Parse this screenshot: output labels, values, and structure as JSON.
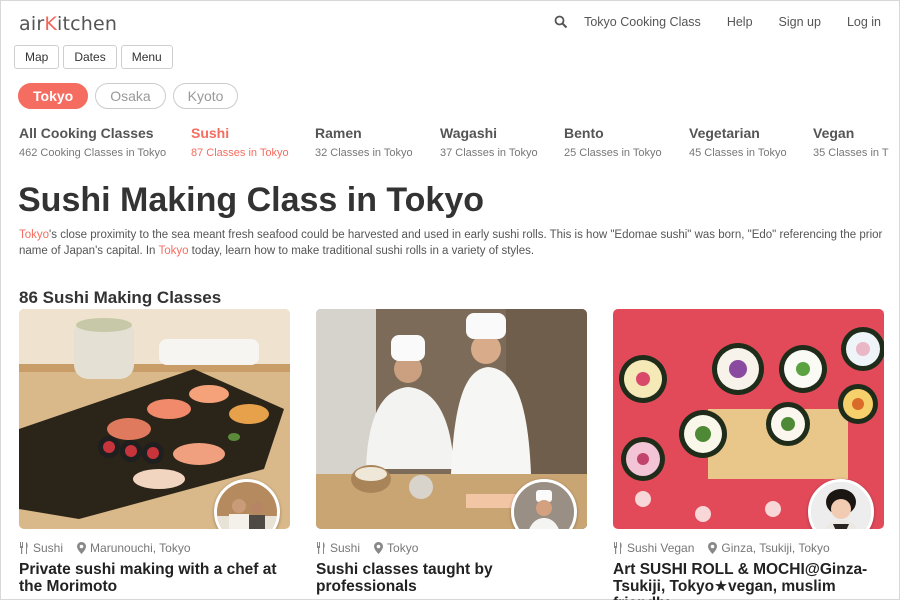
{
  "brand": {
    "logo_pre": "air",
    "logo_k": "K",
    "logo_post": "itchen"
  },
  "topnav": {
    "link1": "Tokyo Cooking Class",
    "link2": "Help",
    "link3": "Sign up",
    "link4": "Log in"
  },
  "filters": {
    "map": "Map",
    "dates": "Dates",
    "menu": "Menu"
  },
  "cities": [
    "Tokyo",
    "Osaka",
    "Kyoto"
  ],
  "categories": [
    {
      "name": "All Cooking Classes",
      "count": "462 Cooking Classes in Tokyo"
    },
    {
      "name": "Sushi",
      "count": "87 Classes in Tokyo"
    },
    {
      "name": "Ramen",
      "count": "32 Classes in Tokyo"
    },
    {
      "name": "Wagashi",
      "count": "37 Classes in Tokyo"
    },
    {
      "name": "Bento",
      "count": "25 Classes in Tokyo"
    },
    {
      "name": "Vegetarian",
      "count": "45 Classes in Tokyo"
    },
    {
      "name": "Vegan",
      "count": "35 Classes in T"
    }
  ],
  "page": {
    "title": "Sushi Making Class in Tokyo",
    "desc_link1": "Tokyo",
    "desc_part1": "'s close proximity to the sea meant fresh seafood could be harvested and used in early sushi rolls. This is how \"Edomae sushi\" was born, \"Edo\" referencing the prior name of Japan's capital. In ",
    "desc_link2": "Tokyo",
    "desc_part2": " today, learn how to make traditional sushi rolls in a variety of styles.",
    "count_heading": "86 Sushi Making Classes"
  },
  "cards": [
    {
      "tags": "Sushi",
      "location": "Marunouchi,  Tokyo",
      "title": "Private sushi making with a chef at the Morimoto"
    },
    {
      "tags": "Sushi",
      "location": "Tokyo",
      "title": "Sushi classes taught by professionals"
    },
    {
      "tags": "Sushi  Vegan",
      "location": "Ginza,  Tsukiji,  Tokyo",
      "title": "Art SUSHI ROLL & MOCHI@Ginza-Tsukiji, Tokyo★vegan, muslim friendly"
    }
  ],
  "icons": {
    "search": "search-icon",
    "utensils": "utensils-icon",
    "pin": "map-pin-icon"
  },
  "colors": {
    "accent": "#f46d60",
    "text": "#333333",
    "muted": "#777777"
  }
}
